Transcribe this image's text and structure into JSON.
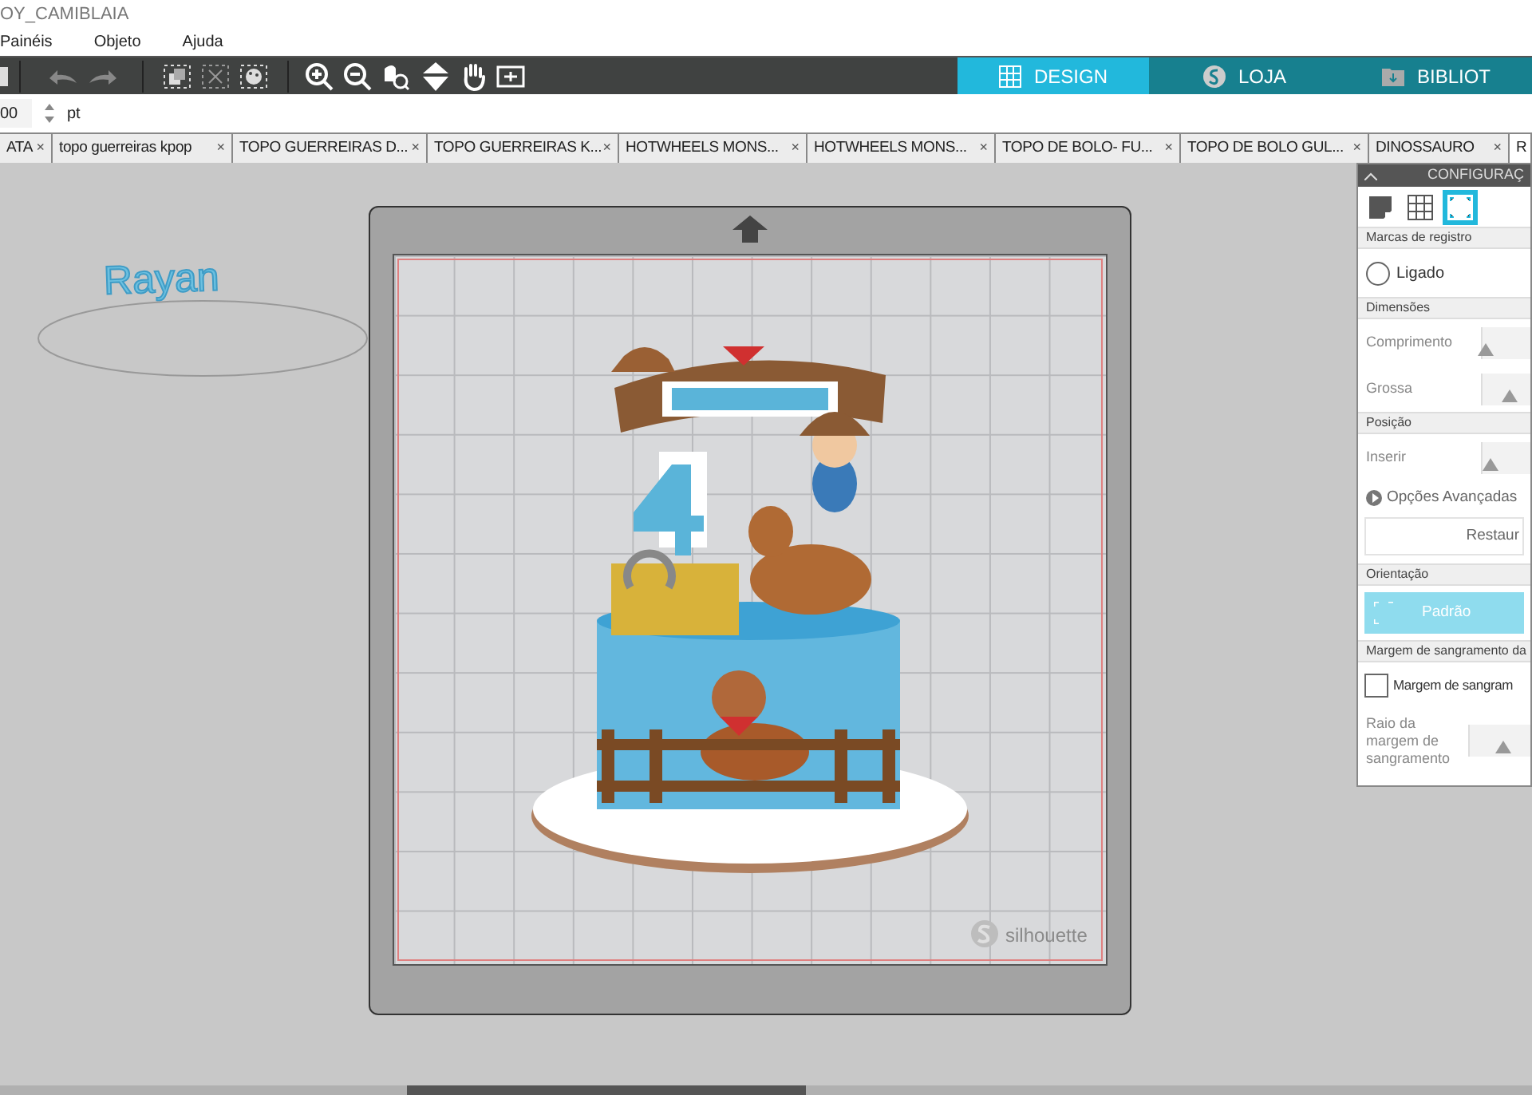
{
  "window": {
    "title": "OY_CAMIBLAIA"
  },
  "menu": [
    "Painéis",
    "Objeto",
    "Ajuda"
  ],
  "nav_tabs": [
    {
      "label": "DESIGN",
      "selected": true
    },
    {
      "label": "LOJA",
      "selected": false
    },
    {
      "label": "BIBLIOT",
      "selected": false
    }
  ],
  "size_field": {
    "value": "00",
    "unit": "pt"
  },
  "document_tabs": [
    {
      "label": "ATA",
      "close": "×",
      "selected": false
    },
    {
      "label": "topo guerreiras kpop",
      "close": "×",
      "selected": false
    },
    {
      "label": "TOPO GUERREIRAS D...",
      "close": "×",
      "selected": false
    },
    {
      "label": "TOPO GUERREIRAS K...",
      "close": "×",
      "selected": false
    },
    {
      "label": "HOTWHEELS MONS...",
      "close": "×",
      "selected": false
    },
    {
      "label": "HOTWHEELS MONS...",
      "close": "×",
      "selected": false
    },
    {
      "label": "TOPO DE BOLO- FU...",
      "close": "×",
      "selected": false
    },
    {
      "label": "TOPO DE BOLO GUL...",
      "close": "×",
      "selected": false
    },
    {
      "label": "DINOSSAURO",
      "close": "×",
      "selected": false
    },
    {
      "label": "R",
      "selected": true
    }
  ],
  "canvas": {
    "text_object": "Rayan",
    "mat_logo": "silhouette"
  },
  "panel": {
    "title": "CONFIGURAÇ",
    "view_tabs": [
      {
        "selected": false
      },
      {
        "selected": false
      },
      {
        "selected": true
      }
    ],
    "rows": [
      {
        "kind": "header",
        "label": "Marcas de registro"
      },
      {
        "kind": "radio",
        "label": "Ligado",
        "checked": false
      },
      {
        "kind": "header",
        "label": "Dimensões"
      },
      {
        "kind": "slider",
        "label": "Comprimento",
        "level": 0.05
      },
      {
        "kind": "slider",
        "label": "Grossa",
        "level": 0.55
      },
      {
        "kind": "header",
        "label": "Posição"
      },
      {
        "kind": "slider",
        "label": "Inserir",
        "level": 0.15
      },
      {
        "kind": "expander",
        "label": "Opções Avançadas",
        "expanded": false
      },
      {
        "kind": "button",
        "label": "Restaur"
      },
      {
        "kind": "header",
        "label": "Orientação"
      },
      {
        "kind": "toggle",
        "label": "Padrão",
        "selected": true
      },
      {
        "kind": "header",
        "label": "Margem de sangramento da"
      },
      {
        "kind": "checkbox",
        "label": "Margem de sangram",
        "checked": false
      },
      {
        "kind": "slider",
        "label": "Raio da margem de sangramento",
        "level": 0.55
      }
    ]
  }
}
